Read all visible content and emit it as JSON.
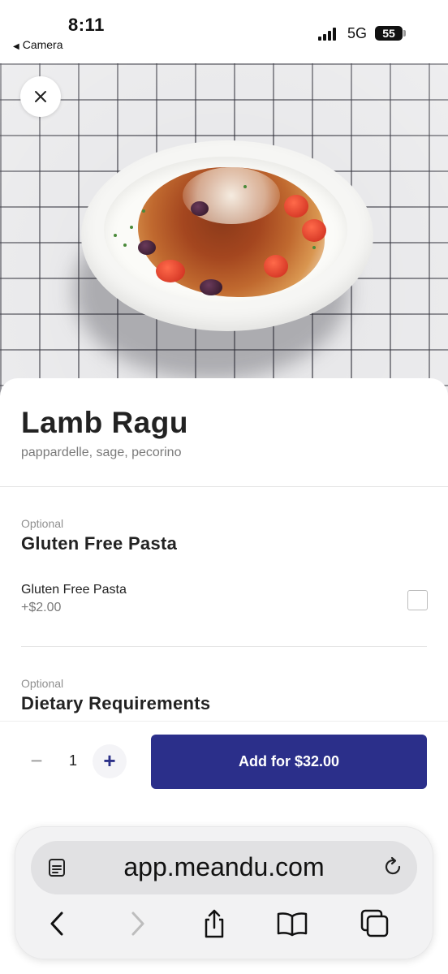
{
  "status_bar": {
    "time": "8:11",
    "back_app": "Camera",
    "network": "5G",
    "battery": "55"
  },
  "item": {
    "name": "Lamb Ragu",
    "description": "pappardelle, sage, pecorino",
    "image_icon": "dish-photo"
  },
  "modifier_groups": [
    {
      "optional_label": "Optional",
      "title": "Gluten Free Pasta",
      "choices": [
        {
          "name": "Gluten Free Pasta",
          "price": "+$2.00",
          "checked": false
        }
      ]
    },
    {
      "optional_label": "Optional",
      "title": "Dietary Requirements"
    }
  ],
  "order": {
    "minus": "−",
    "quantity": "1",
    "plus": "+",
    "add_label": "Add for $32.00"
  },
  "browser": {
    "url": "app.meandu.com"
  },
  "colors": {
    "accent": "#2b2f8a",
    "text": "#222222",
    "muted": "#7a7a7a"
  }
}
